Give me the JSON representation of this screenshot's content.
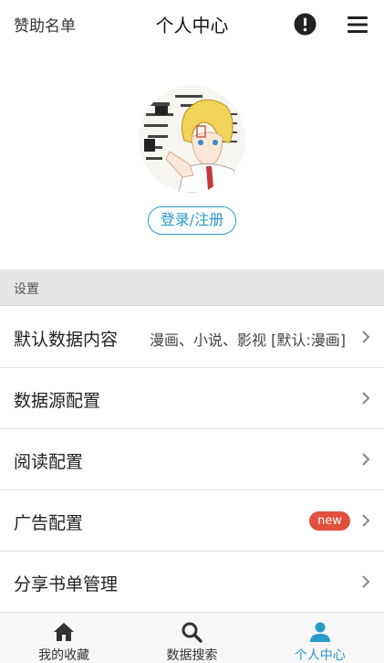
{
  "header": {
    "sponsor_link": "赞助名单",
    "title": "个人中心",
    "alert_icon": "exclamation-circle-icon",
    "menu_icon": "hamburger-menu-icon"
  },
  "profile": {
    "avatar_icon": "avatar-anime-boy",
    "login_label": "登录/注册"
  },
  "settings": {
    "section_title": "设置",
    "items": [
      {
        "label": "默认数据内容",
        "value": "漫画、小说、影视 [默认:漫画]"
      },
      {
        "label": "数据源配置"
      },
      {
        "label": "阅读配置"
      },
      {
        "label": "广告配置",
        "badge": "new"
      },
      {
        "label": "分享书单管理"
      }
    ]
  },
  "tabs": [
    {
      "label": "我的收藏",
      "icon": "home-icon"
    },
    {
      "label": "数据搜索",
      "icon": "search-icon"
    },
    {
      "label": "个人中心",
      "icon": "user-icon",
      "active": true
    }
  ],
  "colors": {
    "accent": "#2b9ac9",
    "badge": "#e0503d",
    "section_bg": "#e6e6e6"
  }
}
